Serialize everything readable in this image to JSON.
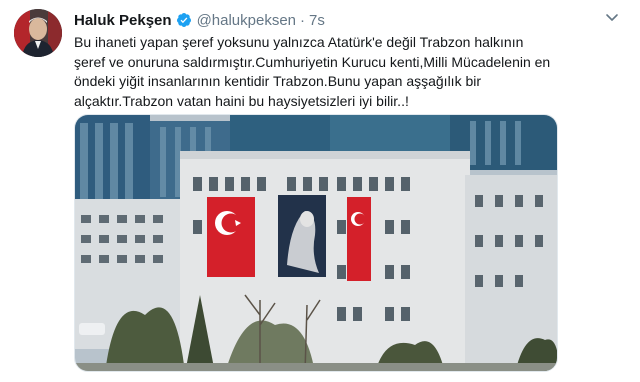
{
  "user": {
    "name": "Haluk Pekşen",
    "handle": "@halukpeksen",
    "separator": "·",
    "time": "7s"
  },
  "tweet": {
    "lines": [
      "Bu ihaneti yapan şeref yoksunu yalnızca Atatürk'e değil Trabzon halkının",
      "şeref ve onuruna saldırmıştır.Cumhuriyetin Kurucu kenti,Milli Mücadelenin en",
      "öndeki yiğit insanlarının kentidir Trabzon.Bunu yapan aşşağılık bir",
      "alçaktır.Trabzon vatan haini bu  haysiyetsizleri iyi bilir..!"
    ]
  },
  "icons": {
    "verified": "verified-badge-icon",
    "menu": "chevron-down-icon"
  },
  "colors": {
    "verified": "#1da1f2",
    "handle": "#657786",
    "flag_red": "#d4202a"
  },
  "media": {
    "description_icon": "photo-building-flags"
  }
}
